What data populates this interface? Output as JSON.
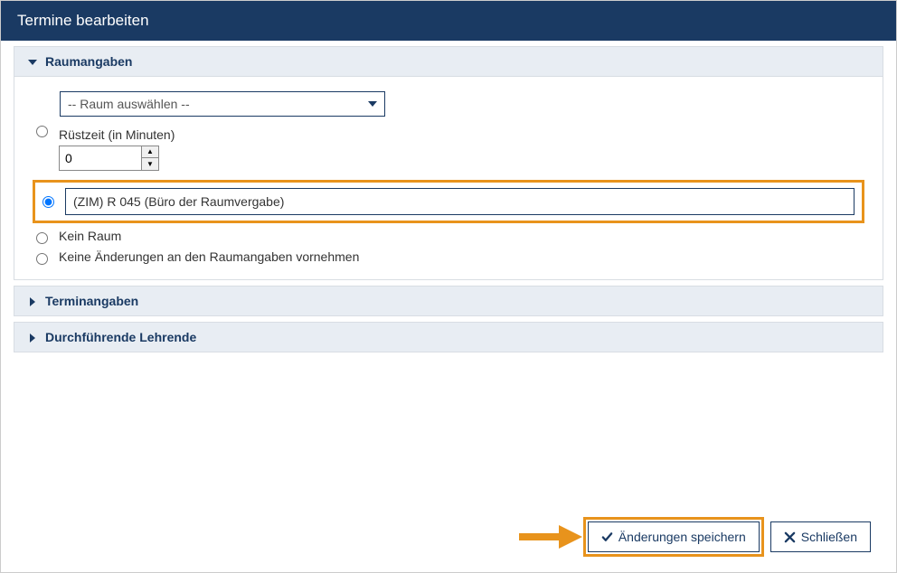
{
  "dialog": {
    "title": "Termine bearbeiten"
  },
  "panels": {
    "raumangaben": {
      "title": "Raumangaben"
    },
    "terminangaben": {
      "title": "Terminangaben"
    },
    "lehrende": {
      "title": "Durchführende Lehrende"
    }
  },
  "room": {
    "select_placeholder": "-- Raum auswählen --",
    "ruestzeit_label": "Rüstzeit (in Minuten)",
    "ruestzeit_value": "0",
    "free_text_value": "(ZIM) R 045 (Büro der Raumvergabe)",
    "kein_raum": "Kein Raum",
    "keine_aenderung": "Keine Änderungen an den Raumangaben vornehmen"
  },
  "buttons": {
    "save": "Änderungen speichern",
    "close": "Schließen"
  }
}
